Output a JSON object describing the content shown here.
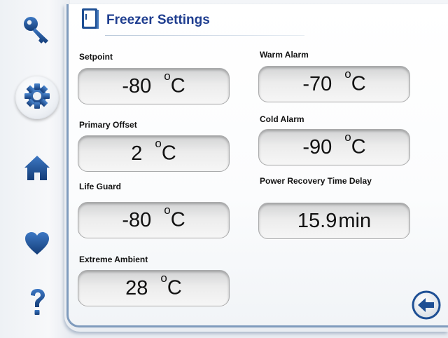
{
  "title": "Freezer Settings",
  "fields": {
    "setpoint": {
      "label": "Setpoint",
      "value": "-80",
      "unit": "C",
      "deg": "o"
    },
    "primary_offset": {
      "label": "Primary Offset",
      "value": "2",
      "unit": "C",
      "deg": "o"
    },
    "life_guard": {
      "label": "Life Guard",
      "value": "-80",
      "unit": "C",
      "deg": "o"
    },
    "extreme_ambient": {
      "label": "Extreme Ambient",
      "value": "28",
      "unit": "C",
      "deg": "o"
    },
    "warm_alarm": {
      "label": "Warm Alarm",
      "value": "-70",
      "unit": "C",
      "deg": "o"
    },
    "cold_alarm": {
      "label": "Cold Alarm",
      "value": "-90",
      "unit": "C",
      "deg": "o"
    },
    "power_recovery": {
      "label": "Power Recovery Time Delay",
      "value": "15.9",
      "unit": "min"
    }
  },
  "sidebar": {
    "items": [
      {
        "icon": "key-icon"
      },
      {
        "icon": "gear-icon",
        "active": true
      },
      {
        "icon": "home-icon"
      },
      {
        "icon": "heart-icon"
      },
      {
        "icon": "help-icon"
      }
    ]
  },
  "colors": {
    "accent": "#1e3d8f",
    "icon": "#1f4d8c",
    "panel_border": "#7f9bbd"
  }
}
